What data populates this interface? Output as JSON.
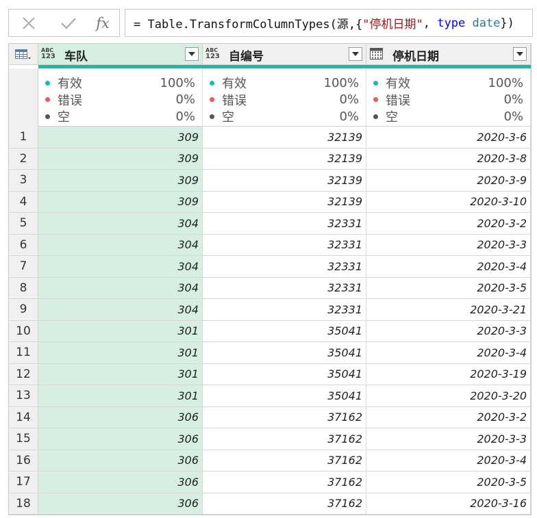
{
  "formula_bar": {
    "cancel_icon": "close-icon",
    "ok_icon": "check-icon",
    "fx_label": "fx",
    "tokens": [
      {
        "text": "= Table.TransformColumnTypes(源,{",
        "kind": "plain"
      },
      {
        "text": "\"停机日期\"",
        "kind": "str"
      },
      {
        "text": ", ",
        "kind": "plain"
      },
      {
        "text": "type",
        "kind": "kw"
      },
      {
        "text": " ",
        "kind": "plain"
      },
      {
        "text": "date",
        "kind": "type"
      },
      {
        "text": "})",
        "kind": "plain"
      }
    ]
  },
  "columns": [
    {
      "key": "team",
      "title": "车队",
      "type_icon": "abc-123-type-icon",
      "type_top": "ABC",
      "type_bottom": "123",
      "selected": true
    },
    {
      "key": "id",
      "title": "自编号",
      "type_icon": "abc-123-type-icon",
      "type_top": "ABC",
      "type_bottom": "123",
      "selected": false
    },
    {
      "key": "date",
      "title": "停机日期",
      "type_icon": "calendar-icon",
      "type_top": "",
      "type_bottom": "",
      "selected": false
    }
  ],
  "quality": {
    "labels": [
      "有效",
      "错误",
      "空"
    ],
    "colors": [
      "#1fb8a8",
      "#e85a5a",
      "#555555"
    ],
    "values": [
      [
        "100%",
        "0%",
        "0%"
      ],
      [
        "100%",
        "0%",
        "0%"
      ],
      [
        "100%",
        "0%",
        "0%"
      ]
    ]
  },
  "rows": [
    {
      "n": "1",
      "team": "309",
      "id": "32139",
      "date": "2020-3-6"
    },
    {
      "n": "2",
      "team": "309",
      "id": "32139",
      "date": "2020-3-8"
    },
    {
      "n": "3",
      "team": "309",
      "id": "32139",
      "date": "2020-3-9"
    },
    {
      "n": "4",
      "team": "309",
      "id": "32139",
      "date": "2020-3-10"
    },
    {
      "n": "5",
      "team": "304",
      "id": "32331",
      "date": "2020-3-2"
    },
    {
      "n": "6",
      "team": "304",
      "id": "32331",
      "date": "2020-3-3"
    },
    {
      "n": "7",
      "team": "304",
      "id": "32331",
      "date": "2020-3-4"
    },
    {
      "n": "8",
      "team": "304",
      "id": "32331",
      "date": "2020-3-5"
    },
    {
      "n": "9",
      "team": "304",
      "id": "32331",
      "date": "2020-3-21"
    },
    {
      "n": "10",
      "team": "301",
      "id": "35041",
      "date": "2020-3-3"
    },
    {
      "n": "11",
      "team": "301",
      "id": "35041",
      "date": "2020-3-4"
    },
    {
      "n": "12",
      "team": "301",
      "id": "35041",
      "date": "2020-3-19"
    },
    {
      "n": "13",
      "team": "301",
      "id": "35041",
      "date": "2020-3-20"
    },
    {
      "n": "14",
      "team": "306",
      "id": "37162",
      "date": "2020-3-2"
    },
    {
      "n": "15",
      "team": "306",
      "id": "37162",
      "date": "2020-3-3"
    },
    {
      "n": "16",
      "team": "306",
      "id": "37162",
      "date": "2020-3-4"
    },
    {
      "n": "17",
      "team": "306",
      "id": "37162",
      "date": "2020-3-5"
    },
    {
      "n": "18",
      "team": "306",
      "id": "37162",
      "date": "2020-3-16"
    }
  ]
}
